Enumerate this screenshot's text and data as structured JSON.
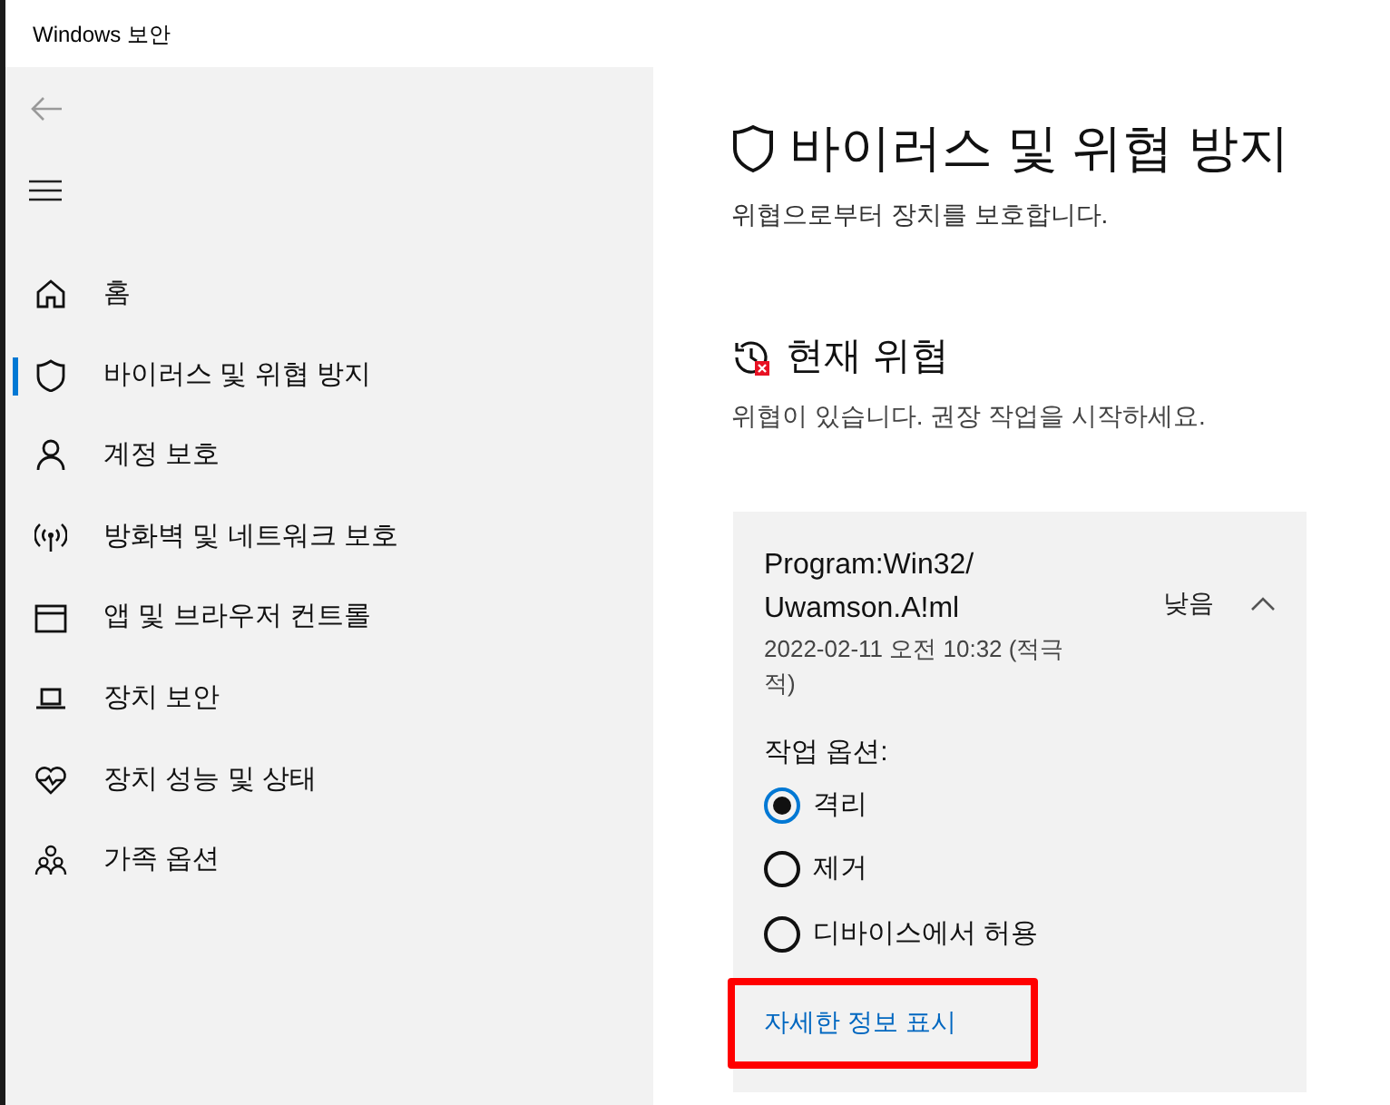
{
  "window": {
    "title": "Windows 보안"
  },
  "sidebar": {
    "items": [
      {
        "label": "홈",
        "selected": false
      },
      {
        "label": "바이러스 및 위협 방지",
        "selected": true
      },
      {
        "label": "계정 보호",
        "selected": false
      },
      {
        "label": "방화벽 및 네트워크 보호",
        "selected": false
      },
      {
        "label": "앱 및 브라우저 컨트롤",
        "selected": false
      },
      {
        "label": "장치 보안",
        "selected": false
      },
      {
        "label": "장치 성능 및 상태",
        "selected": false
      },
      {
        "label": "가족 옵션",
        "selected": false
      }
    ]
  },
  "page": {
    "title": "바이러스 및 위협 방지",
    "subtitle": "위협으로부터 장치를 보호합니다."
  },
  "current_threats": {
    "heading": "현재 위협",
    "message": "위협이 있습니다. 권장 작업을 시작하세요.",
    "threat": {
      "name": "Program:Win32/Uwamson.A!ml",
      "time": "2022-02-11 오전 10:32 (적극적)",
      "severity": "낮음",
      "expanded": true,
      "options_label": "작업 옵션:",
      "options": [
        {
          "label": "격리",
          "selected": true
        },
        {
          "label": "제거",
          "selected": false
        },
        {
          "label": "디바이스에서 허용",
          "selected": false
        }
      ],
      "details_link": {
        "label": "자세한 정보 표시",
        "highlighted": true
      }
    }
  }
}
